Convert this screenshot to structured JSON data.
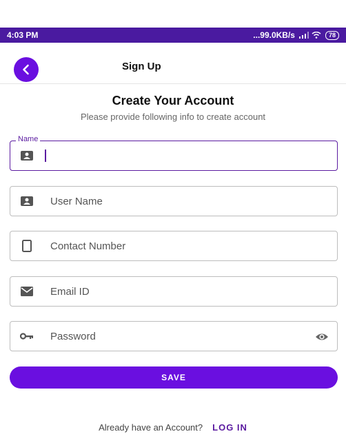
{
  "status_bar": {
    "time": "4:03 PM",
    "network_speed": "...99.0KB/s",
    "battery": "78"
  },
  "header": {
    "title": "Sign Up",
    "back_icon": "chevron-left-icon"
  },
  "main": {
    "title": "Create Your Account",
    "subtitle": "Please provide following info to create account"
  },
  "form": {
    "name": {
      "label": "Name",
      "value": "",
      "icon": "id-card-icon"
    },
    "username": {
      "placeholder": "User Name",
      "icon": "id-card-icon"
    },
    "contact": {
      "placeholder": "Contact Number",
      "icon": "phone-icon"
    },
    "email": {
      "placeholder": "Email ID",
      "icon": "mail-icon"
    },
    "password": {
      "placeholder": "Password",
      "icon": "key-icon",
      "toggle_icon": "eye-icon"
    }
  },
  "save_button": {
    "label": "SAVE"
  },
  "footer": {
    "text": "Already have an Account?",
    "link": "LOG IN"
  },
  "colors": {
    "primary": "#6a0fe0",
    "status_bar": "#4a1aa0"
  }
}
